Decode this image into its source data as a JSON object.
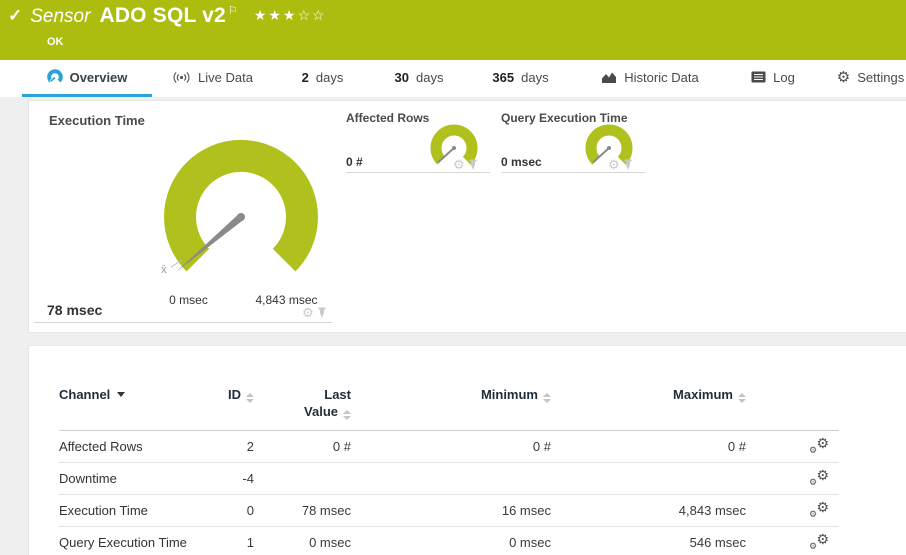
{
  "header": {
    "kind_label": "Sensor",
    "title": "ADO SQL v2",
    "status": "OK",
    "stars_filled": "★★★",
    "stars_empty": "☆☆"
  },
  "tabs": {
    "overview": {
      "label": "Overview"
    },
    "live_data": {
      "label": "Live Data"
    },
    "days2": {
      "num": "2",
      "label": "days"
    },
    "days30": {
      "num": "30",
      "label": "days"
    },
    "days365": {
      "num": "365",
      "label": "days"
    },
    "historic": {
      "label": "Historic Data"
    },
    "log": {
      "label": "Log"
    },
    "settings": {
      "label": "Settings"
    }
  },
  "gauges": {
    "main": {
      "title": "Execution Time",
      "value": "78 msec",
      "min_label": "0 msec",
      "max_label": "4,843 msec",
      "avg_marker": "x̄"
    },
    "small": [
      {
        "title": "Affected Rows",
        "value": "0 #"
      },
      {
        "title": "Query Execution Time",
        "value": "0 msec"
      }
    ]
  },
  "table": {
    "headers": {
      "channel": "Channel",
      "id": "ID",
      "last_line1": "Last",
      "last_line2": "Value",
      "min": "Minimum",
      "max": "Maximum"
    },
    "rows": [
      {
        "channel": "Affected Rows",
        "id": "2",
        "last": "0 #",
        "min": "0 #",
        "max": "0 #"
      },
      {
        "channel": "Downtime",
        "id": "-4",
        "last": "",
        "min": "",
        "max": ""
      },
      {
        "channel": "Execution Time",
        "id": "0",
        "last": "78 msec",
        "min": "16 msec",
        "max": "4,843 msec"
      },
      {
        "channel": "Query Execution Time",
        "id": "1",
        "last": "0 msec",
        "min": "0 msec",
        "max": "546 msec"
      }
    ]
  },
  "colors": {
    "header_green": "#acbd10",
    "gauge_green": "#b0c11d",
    "needle_gray": "#8a8a8a",
    "accent_blue": "#2aa3d8"
  }
}
